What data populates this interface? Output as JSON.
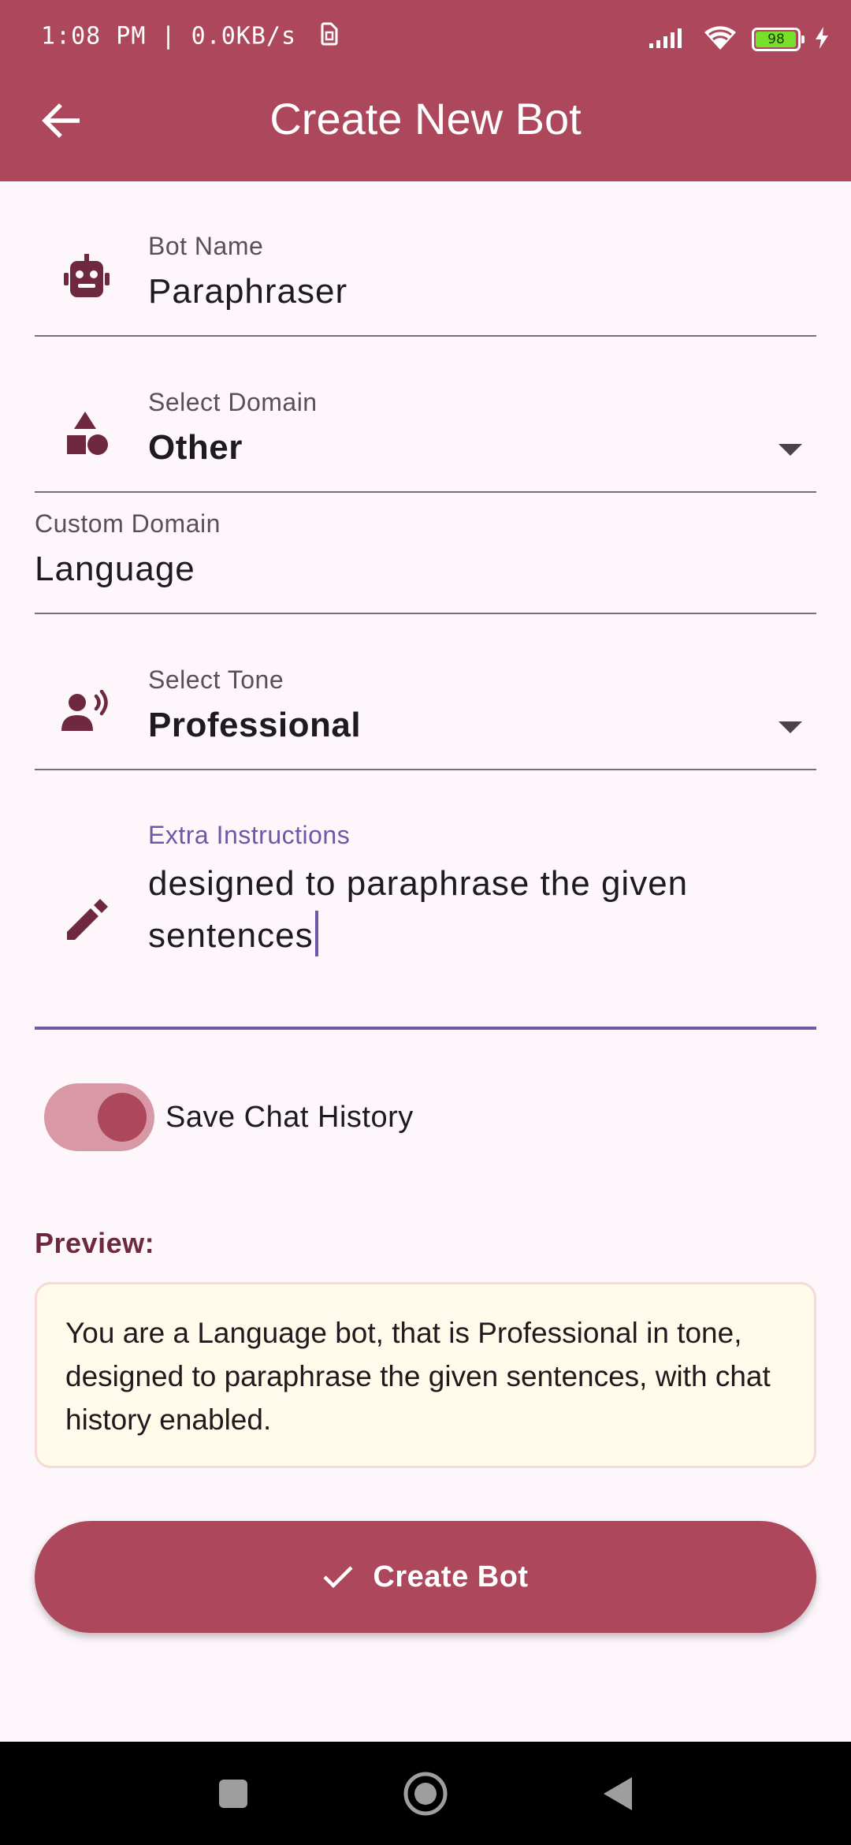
{
  "status_bar": {
    "time_and_speed": "1:08 PM | 0.0KB/s",
    "battery_percent": 98,
    "battery_text": "98"
  },
  "app_bar": {
    "title": "Create New Bot",
    "back_icon": "arrow-back-icon"
  },
  "form": {
    "bot_name": {
      "label": "Bot Name",
      "value": "Paraphraser",
      "icon": "robot-icon"
    },
    "domain": {
      "label": "Select Domain",
      "value": "Other",
      "icon": "category-shapes-icon"
    },
    "custom_domain": {
      "label": "Custom Domain",
      "value": "Language"
    },
    "tone": {
      "label": "Select Tone",
      "value": "Professional",
      "icon": "record-voice-icon"
    },
    "extra_instructions": {
      "label": "Extra Instructions",
      "value": "designed to paraphrase the given sentences",
      "icon": "edit-pencil-icon"
    }
  },
  "save_history": {
    "label": "Save Chat History",
    "enabled": true
  },
  "preview": {
    "heading": "Preview:",
    "text": "You are a Language bot, that is Professional in tone, designed to paraphrase the given sentences, with chat history enabled."
  },
  "create_button": {
    "label": "Create Bot",
    "icon": "check-icon"
  },
  "colors": {
    "primary": "#ad475c",
    "background": "#fdf7fc",
    "focus": "#6b59a8",
    "preview_bg": "#fffaea",
    "icon": "#6e2840"
  }
}
